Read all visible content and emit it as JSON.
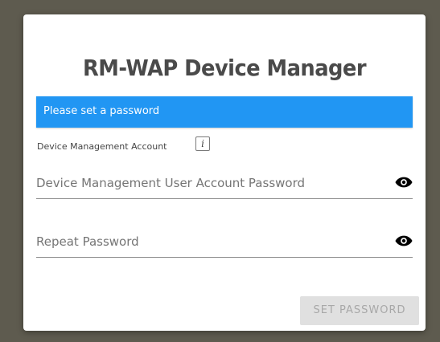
{
  "app": {
    "title": "RM-WAP Device Manager"
  },
  "banner": {
    "message": "Please set a password",
    "color": "#2196f3"
  },
  "account": {
    "label": "Device Management Account",
    "info_icon": "info-icon"
  },
  "fields": {
    "password": {
      "placeholder": "Device Management User Account Password",
      "value": "",
      "toggle_icon": "eye-icon"
    },
    "repeat": {
      "placeholder": "Repeat Password",
      "value": "",
      "toggle_icon": "eye-icon"
    }
  },
  "actions": {
    "set_password_label": "SET PASSWORD",
    "set_password_enabled": false
  }
}
